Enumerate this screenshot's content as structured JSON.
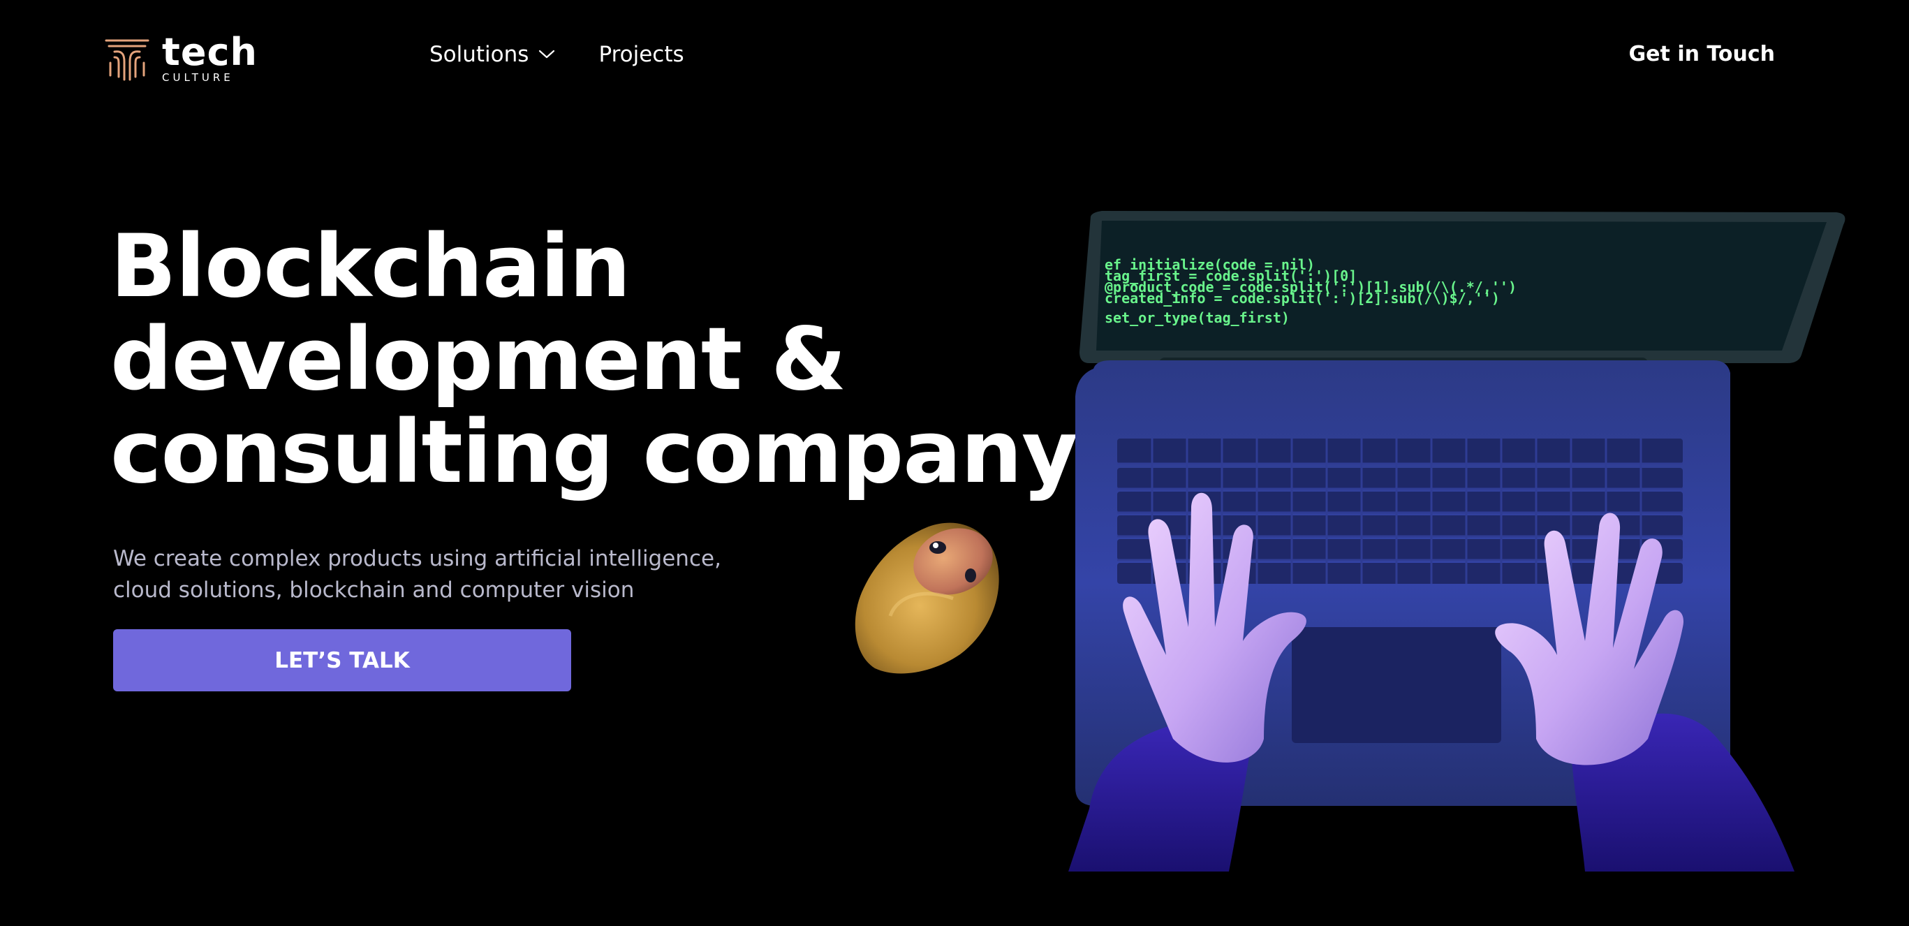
{
  "header": {
    "logo": {
      "word": "tech",
      "sub": "CULTURE",
      "icon": "tech-culture-logo-mark"
    },
    "nav": [
      {
        "label": "Solutions",
        "icon": "chevron-down-icon"
      },
      {
        "label": "Projects"
      }
    ],
    "cta_label": "Get in Touch"
  },
  "hero": {
    "headline": [
      "Blockchain",
      "development &",
      "consulting company"
    ],
    "subtitle": [
      "We create complex products using artificial intelligence,",
      "cloud solutions, blockchain and computer vision"
    ],
    "button_label": "LET’S TALK"
  },
  "illustration": {
    "code_lines": [
      "ef initialize(code = nil)",
      "  tag_first     = code.split(':')[0]",
      "  @product_code = code.split(':')[1].sub(/\\(.*/,'')",
      "  created_info  = code.split(':')[2].sub(/\\)$/,'')",
      "  set_or_type(tag_first)"
    ]
  },
  "colors": {
    "background": "#000000",
    "accent": "#7068dc",
    "subtitle": "#b9b9cc",
    "code": "#69f48c",
    "logo_mark": "#e4a37c"
  }
}
